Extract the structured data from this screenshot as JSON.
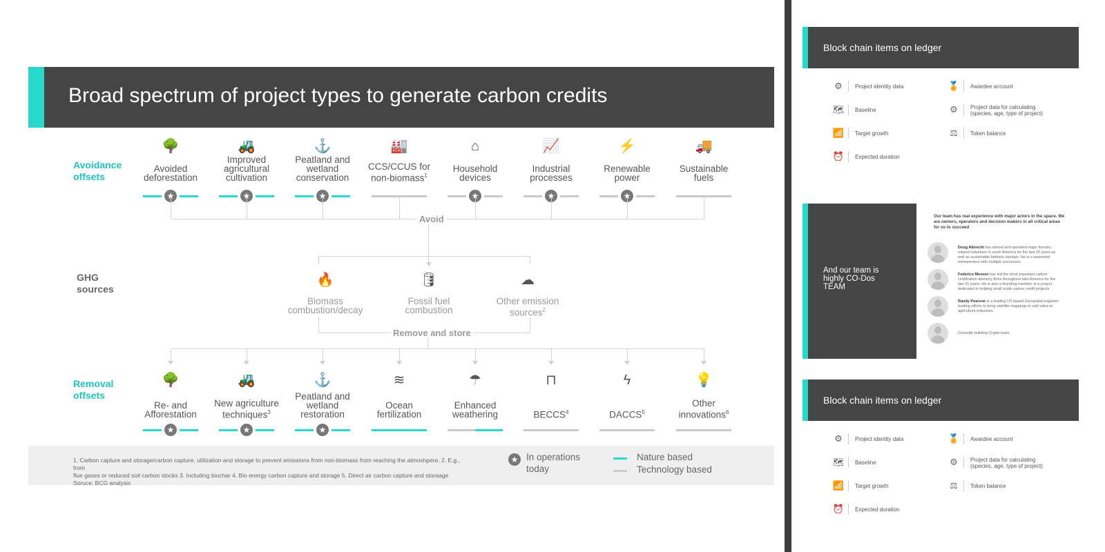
{
  "title": "Broad spectrum of project types to generate carbon credits",
  "row_labels": {
    "avoidance": "Avoidance\noffsets",
    "ghg": "GHG\nsources",
    "removal": "Removal\noffsets"
  },
  "avoidance_items": [
    {
      "label": "Avoided\ndeforestation",
      "icon": "trees-icon",
      "type": "nature",
      "operating": true
    },
    {
      "label": "Improved\nagricultural\ncultivation",
      "icon": "tractor-icon",
      "type": "nature",
      "operating": true
    },
    {
      "label": "Peatland and\nwetland\nconservation",
      "icon": "anchor-icon",
      "type": "nature",
      "operating": true
    },
    {
      "label": "CCS/CCUS for\nnon-biomass",
      "sup": "1",
      "icon": "factory-icon",
      "type": "tech",
      "operating": false
    },
    {
      "label": "Household\ndevices",
      "icon": "house-icon",
      "type": "tech",
      "operating": true
    },
    {
      "label": "Industrial\nprocesses",
      "icon": "chart-icon",
      "type": "tech",
      "operating": true
    },
    {
      "label": "Renewable\npower",
      "icon": "wind-turbine-icon",
      "type": "tech",
      "operating": true
    },
    {
      "label": "Sustainable\nfuels",
      "icon": "truck-icon",
      "type": "tech",
      "operating": false
    }
  ],
  "flow_labels": {
    "avoid": "Avoid",
    "remove": "Remove and store"
  },
  "ghg_items": [
    {
      "label": "Biomass\ncombustion/decay",
      "icon": "flame-icon"
    },
    {
      "label": "Fossil fuel\ncombustion",
      "icon": "fuel-barrel-icon"
    },
    {
      "label": "Other emission\nsources",
      "sup": "2",
      "icon": "cloud-icon"
    }
  ],
  "removal_items": [
    {
      "label": "Re- and\nAfforestation",
      "icon": "trees-icon",
      "type": "nature",
      "operating": true
    },
    {
      "label": "New agriculture\ntechniques",
      "sup": "3",
      "icon": "tractor-icon",
      "type": "nature",
      "operating": true
    },
    {
      "label": "Peatland and\nwetland\nrestoration",
      "icon": "anchor-icon",
      "type": "nature",
      "operating": true
    },
    {
      "label": "Ocean\nfertilization",
      "icon": "waves-icon",
      "type": "nature",
      "operating": false
    },
    {
      "label": "Enhanced\nweathering",
      "icon": "umbrella-icon",
      "type": "mixed",
      "operating": false
    },
    {
      "label": "BECCS",
      "sup": "4",
      "icon": "pipes-icon",
      "type": "tech",
      "operating": false
    },
    {
      "label": "DACCS",
      "sup": "5",
      "icon": "lightning-icon",
      "type": "tech",
      "operating": false
    },
    {
      "label": "Other\ninnovations",
      "sup": "6",
      "icon": "lightbulb-icon",
      "type": "tech",
      "operating": false
    }
  ],
  "footnotes": "1. Carbon capture and storage/carbon capture, utilization and storage to prevent emissions from non-biomass from reaching the atmoshpere. 2. E.g., from\nflue gases or reduced soil carbon stocks 3. Including biochar 4. Bio energy carbon capture and storage 5. Direct air carbon capture and storaage\nSoruce: BCG analysis",
  "legend": {
    "operations": "In operations\ntoday",
    "nature": "Nature based",
    "tech": "Technology based"
  },
  "colors": {
    "accent": "#26d9cc",
    "bar": "#454545",
    "tech_line": "#c9c9c9"
  },
  "panels": {
    "ledger_title": "Block chain items on ledger",
    "ledger_left": [
      "Project identity data",
      "Baseline",
      "Target growth",
      "Expected duration"
    ],
    "ledger_right": [
      "Awardee account",
      "Project data for calculating\n(species, age, type of project)",
      "Token balance"
    ],
    "team_title": "And our team is\nhighly CO-Dos\nTEAM",
    "team_intro": "Our team has real experience with major actors in the space. We are owners, operators and decision makers in all critical areas for us to succeed",
    "team": [
      {
        "name": "Doug Albrecht",
        "bio": " has owned and operated major forestry related industries in south America for the last 20 years as well as sustainable biofuels startups. He is a seasoned entrepreneur with multiple successes."
      },
      {
        "name": "Federico Messen",
        "bio": " has led the most important carbon certification advisory firms throughout latin America for the last 15 years. He is also a founding member of a project dedicated to helping small scale carbon credit projects"
      },
      {
        "name": "Randy Pearson",
        "bio": " is a leading US based Geospatial engineer leading efforts to bring satellite mappings to add value to agriculture industries."
      },
      {
        "name": "",
        "bio": "Currently building Crypto team."
      }
    ]
  }
}
